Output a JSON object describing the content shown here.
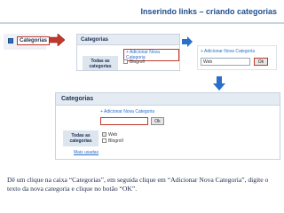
{
  "header": {
    "title": "Inserindo links – criando categorias"
  },
  "step1": {
    "sidebar_label": "Categorias"
  },
  "step2": {
    "panel_title": "Categorias",
    "tab_label": "Todas as categorias",
    "add_link": "+ Adicionar Nova Categoria",
    "checkbox_label": "Blogroll"
  },
  "step3": {
    "add_link": "+ Adicionar Nova Categoria",
    "input_value": "Web",
    "ok_label": "Ok"
  },
  "step4": {
    "panel_title": "Categorias",
    "add_link": "+ Adicionar Nova Categoria",
    "input_value": "",
    "ok_label": "Ok",
    "tab_label": "Todas as categorias",
    "checkbox_1": "Web",
    "checkbox_2": "Blogroll",
    "more_link": "Mais usadas"
  },
  "caption": "Dê um clique na caixa “Categorias”, em seguida clique em “Adicionar Nova Categoria”, digite o texto da nova categoria e clique no botão “OK”.",
  "colors": {
    "accent": "#c0392b",
    "blue_arrow": "#2a6fc9",
    "title": "#1f4e8c"
  }
}
